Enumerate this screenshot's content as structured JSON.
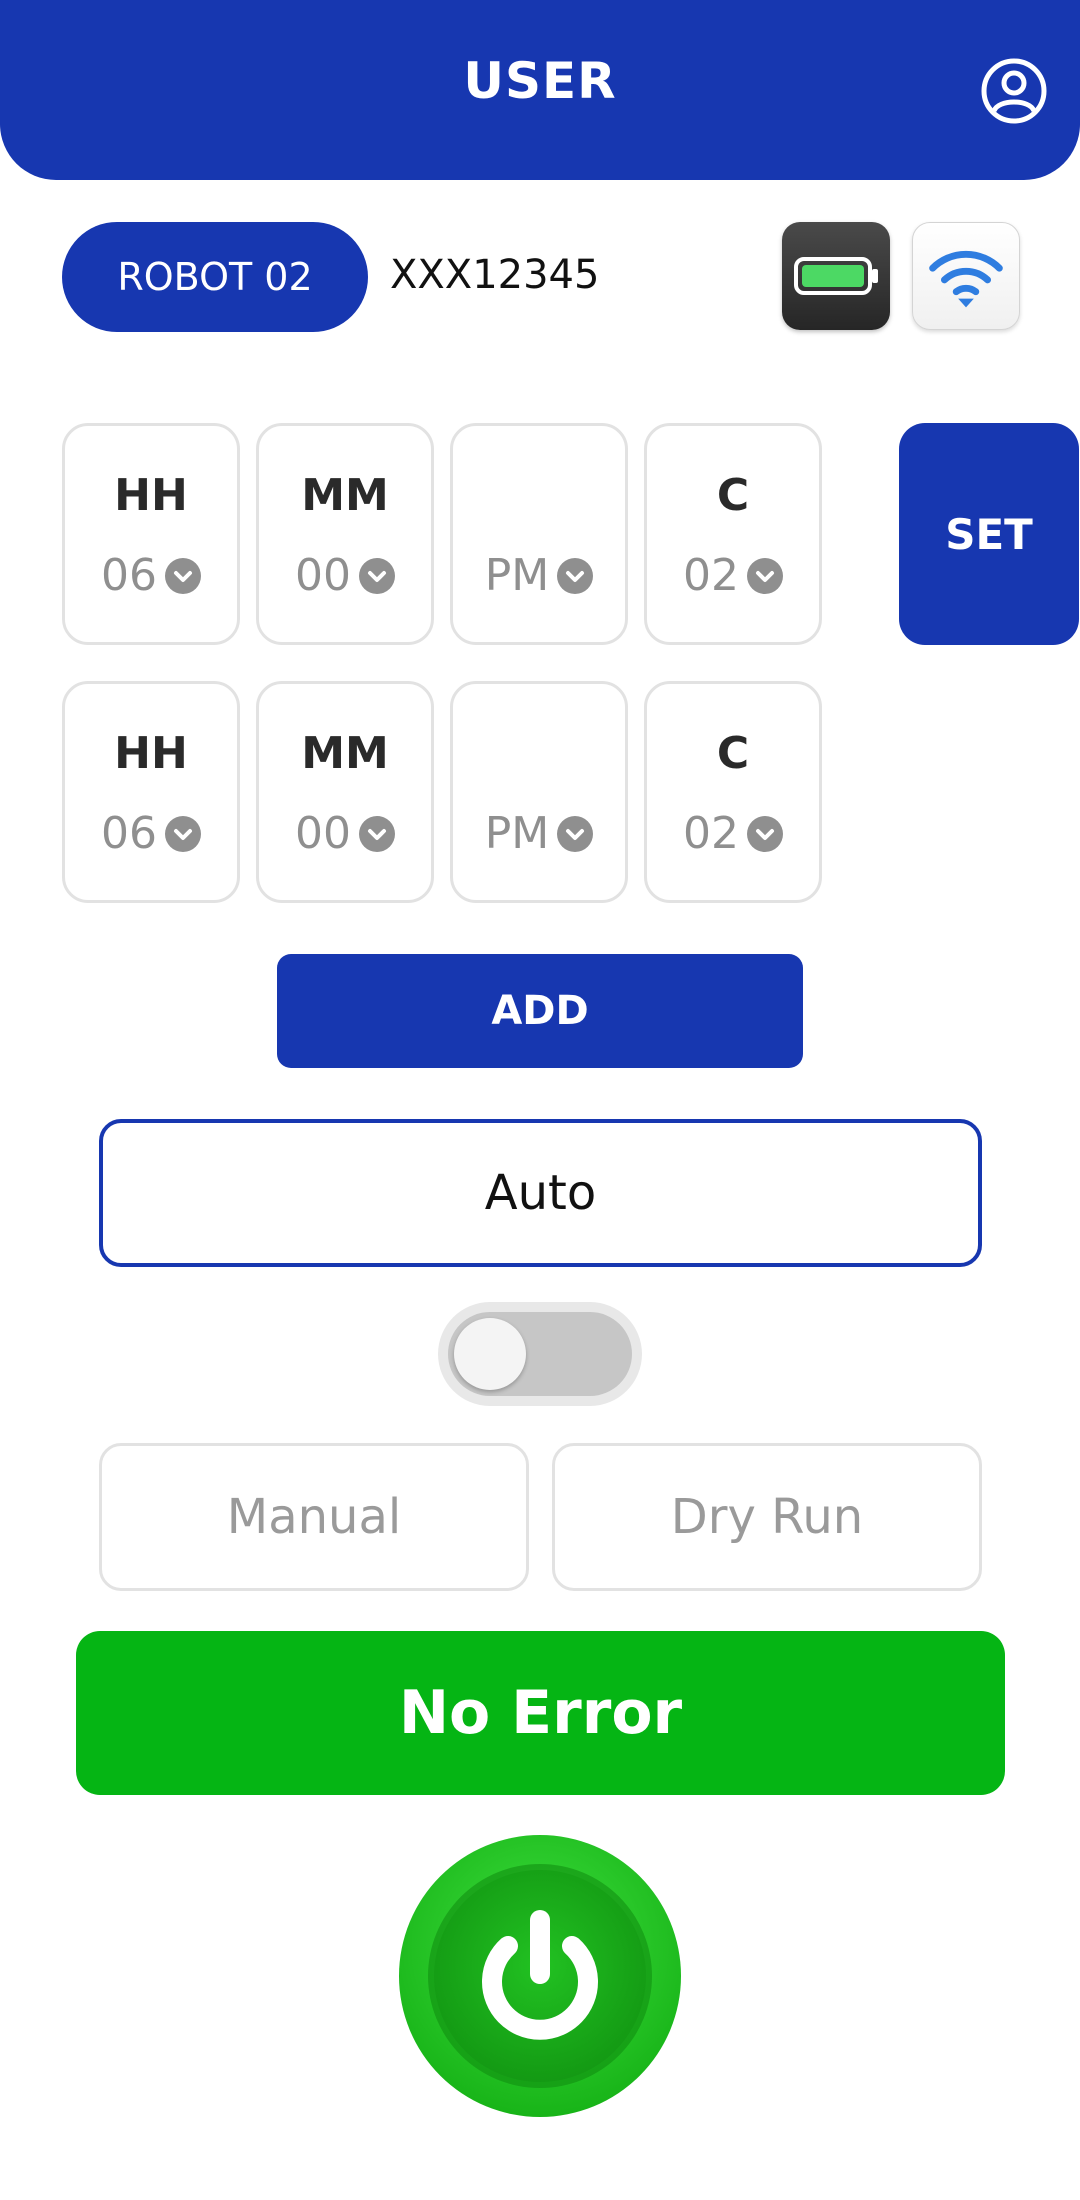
{
  "header": {
    "title": "USER",
    "profile_icon": "user-circle-icon"
  },
  "device": {
    "robot_label": "ROBOT 02",
    "serial": "XXX12345",
    "battery_icon": "battery-full-icon",
    "wifi_icon": "wifi-icon"
  },
  "schedule": {
    "rows": [
      {
        "hour_label": "HH",
        "hour_value": "06",
        "minute_label": "MM",
        "minute_value": "00",
        "period_label": "",
        "period_value": "PM",
        "count_label": "C",
        "count_value": "02"
      },
      {
        "hour_label": "HH",
        "hour_value": "06",
        "minute_label": "MM",
        "minute_value": "00",
        "period_label": "",
        "period_value": "PM",
        "count_label": "C",
        "count_value": "02"
      }
    ],
    "set_label": "SET",
    "add_label": "ADD"
  },
  "mode": {
    "selected": "Auto",
    "toggle_on": false,
    "manual_label": "Manual",
    "dry_run_label": "Dry Run"
  },
  "status": {
    "text": "No Error"
  },
  "power": {
    "icon": "power-icon"
  },
  "colors": {
    "primary": "#1737b0",
    "success": "#05b514",
    "muted_text": "#8f8f8f",
    "border": "#e2e2e2"
  }
}
